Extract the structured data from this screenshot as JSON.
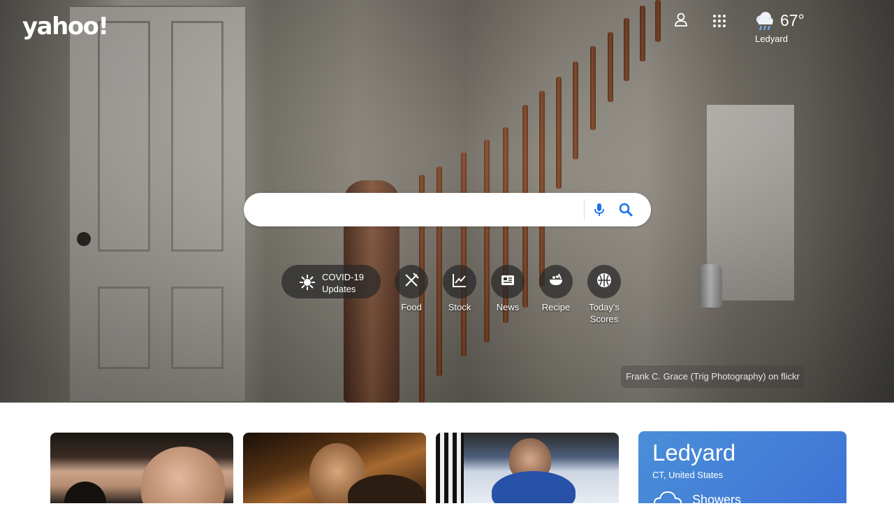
{
  "brand": {
    "logo_text": "yahoo!"
  },
  "header": {
    "weather": {
      "temperature": "67°",
      "location": "Ledyard",
      "icon": "rain-cloud-icon"
    }
  },
  "search": {
    "placeholder": "",
    "value": ""
  },
  "shortcuts": {
    "covid": {
      "line1": "COVID-19",
      "line2": "Updates"
    },
    "items": [
      {
        "label": "Food",
        "icon": "utensils-icon"
      },
      {
        "label": "Stock",
        "icon": "chart-line-icon"
      },
      {
        "label": "News",
        "icon": "newspaper-icon"
      },
      {
        "label": "Recipe",
        "icon": "bowl-icon"
      },
      {
        "label": "Today's",
        "label2": "Scores",
        "icon": "basketball-icon"
      }
    ]
  },
  "photo_credit": "Frank C. Grace (Trig Photography) on flickr",
  "weather_card": {
    "city": "Ledyard",
    "region": "CT, United States",
    "condition": "Showers",
    "accent": "#4a8fd8"
  },
  "colors": {
    "search_blue": "#1a73e8",
    "overlay": "#282828"
  }
}
